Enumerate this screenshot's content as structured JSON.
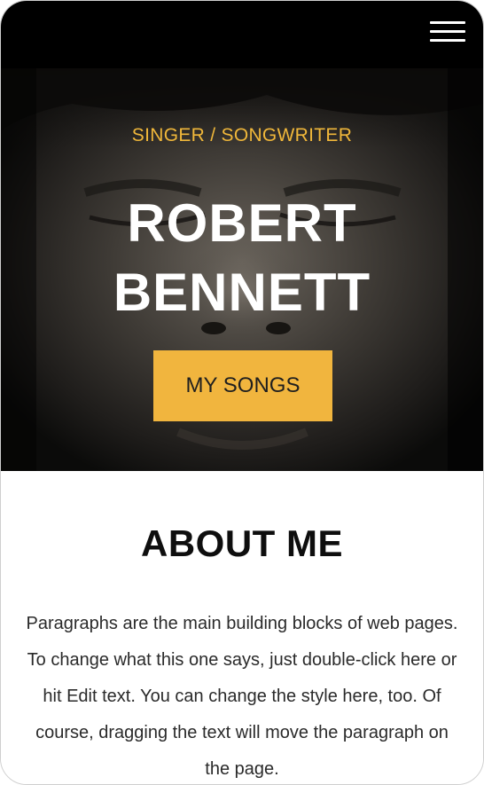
{
  "header": {
    "menu_icon": "hamburger-menu-icon"
  },
  "hero": {
    "tagline": "SINGER / SONGWRITER",
    "name_line1": "ROBERT",
    "name_line2": "BENNETT",
    "button_label": "MY SONGS",
    "accent_color": "#f1b53e"
  },
  "about": {
    "title": "ABOUT ME",
    "paragraph": "Paragraphs are the main building blocks of web pages. To change what this one says, just double-click here or hit Edit text. You can change the style here, too. Of course, dragging the text will move the paragraph on the page."
  }
}
